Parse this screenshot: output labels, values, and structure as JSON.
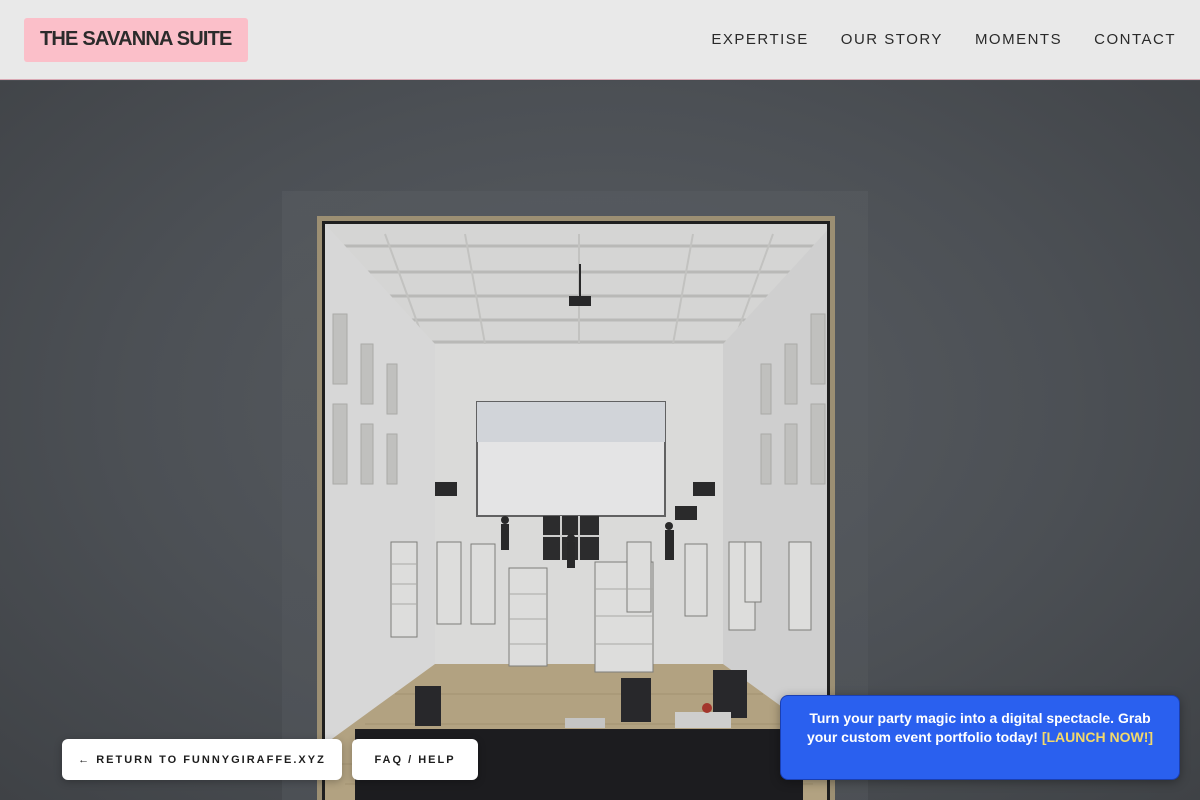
{
  "brand": {
    "name": "THE SAVANNA SUITE"
  },
  "nav": {
    "items": [
      {
        "label": "EXPERTISE"
      },
      {
        "label": "OUR STORY"
      },
      {
        "label": "MOMENTS"
      },
      {
        "label": "CONTACT"
      }
    ]
  },
  "hero": {
    "image_icon": "venue-hall-photo"
  },
  "footer_buttons": {
    "return_label": "← RETURN TO FUNNYGIRAFFE.XYZ",
    "faq_label": "FAQ / HELP"
  },
  "promo": {
    "text": "Turn your party magic into a digital spectacle. Grab your custom event portfolio today!",
    "cta_label": "[LAUNCH NOW!]"
  },
  "colors": {
    "header_bg": "#e9e9e9",
    "logo_bg": "#fbbfc9",
    "promo_bg": "#2a60ef",
    "promo_cta": "#f3d96a"
  }
}
